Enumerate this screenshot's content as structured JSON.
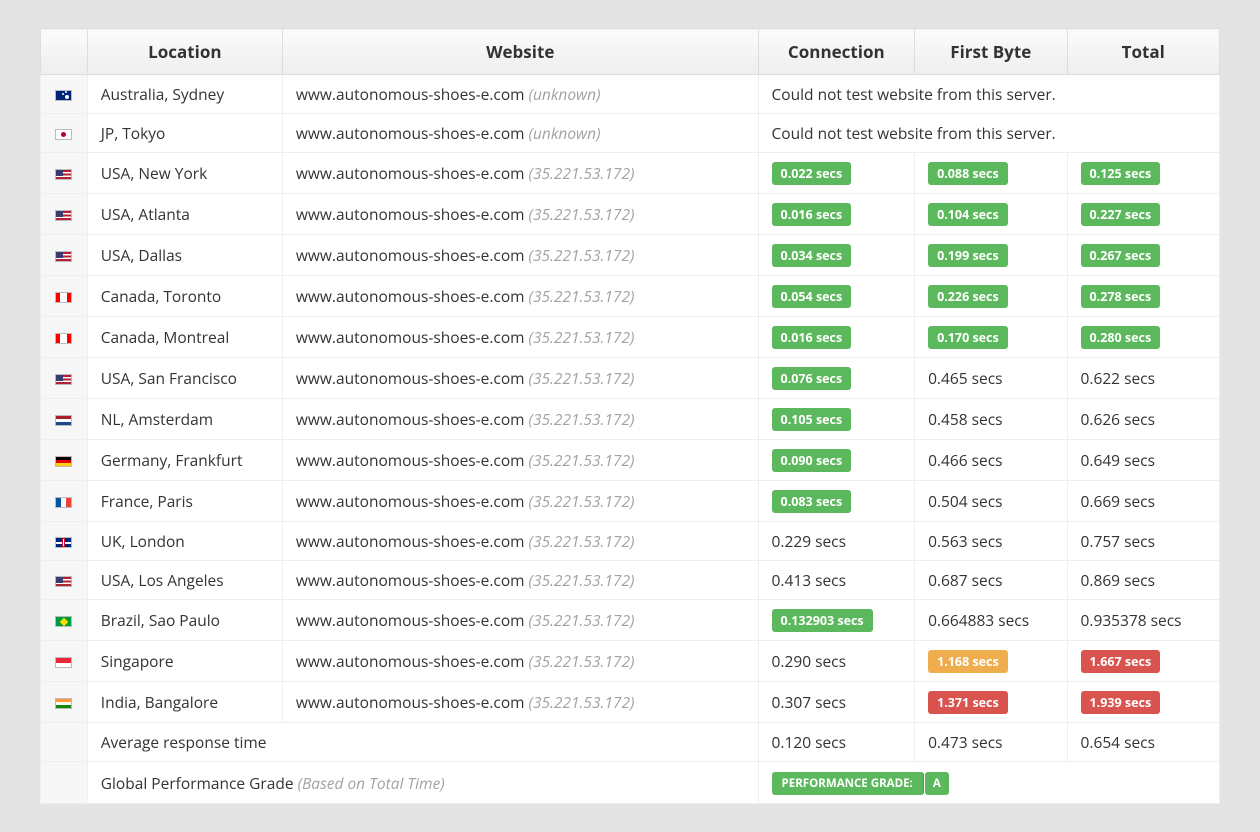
{
  "headers": {
    "location": "Location",
    "website": "Website",
    "connection": "Connection",
    "first_byte": "First Byte",
    "total": "Total"
  },
  "site": {
    "domain": "www.autonomous-shoes-e.com",
    "ip": "(35.221.53.172)",
    "unknown": "(unknown)"
  },
  "error_msg": "Could not test website from this server.",
  "rows": [
    {
      "flag": "au",
      "location": "Australia, Sydney",
      "ip_shown": false,
      "error": true
    },
    {
      "flag": "jp",
      "location": "JP, Tokyo",
      "ip_shown": false,
      "error": true
    },
    {
      "flag": "us",
      "location": "USA, New York",
      "ip_shown": true,
      "conn": {
        "v": "0.022 secs",
        "c": "green"
      },
      "fb": {
        "v": "0.088 secs",
        "c": "green"
      },
      "tot": {
        "v": "0.125 secs",
        "c": "green"
      }
    },
    {
      "flag": "us",
      "location": "USA, Atlanta",
      "ip_shown": true,
      "conn": {
        "v": "0.016 secs",
        "c": "green"
      },
      "fb": {
        "v": "0.104 secs",
        "c": "green"
      },
      "tot": {
        "v": "0.227 secs",
        "c": "green"
      }
    },
    {
      "flag": "us",
      "location": "USA, Dallas",
      "ip_shown": true,
      "conn": {
        "v": "0.034 secs",
        "c": "green"
      },
      "fb": {
        "v": "0.199 secs",
        "c": "green"
      },
      "tot": {
        "v": "0.267 secs",
        "c": "green"
      }
    },
    {
      "flag": "ca",
      "location": "Canada, Toronto",
      "ip_shown": true,
      "conn": {
        "v": "0.054 secs",
        "c": "green"
      },
      "fb": {
        "v": "0.226 secs",
        "c": "green"
      },
      "tot": {
        "v": "0.278 secs",
        "c": "green"
      }
    },
    {
      "flag": "ca",
      "location": "Canada, Montreal",
      "ip_shown": true,
      "conn": {
        "v": "0.016 secs",
        "c": "green"
      },
      "fb": {
        "v": "0.170 secs",
        "c": "green"
      },
      "tot": {
        "v": "0.280 secs",
        "c": "green"
      }
    },
    {
      "flag": "us",
      "location": "USA, San Francisco",
      "ip_shown": true,
      "conn": {
        "v": "0.076 secs",
        "c": "green"
      },
      "fb": {
        "v": "0.465 secs",
        "c": "plain"
      },
      "tot": {
        "v": "0.622 secs",
        "c": "plain"
      }
    },
    {
      "flag": "nl",
      "location": "NL, Amsterdam",
      "ip_shown": true,
      "conn": {
        "v": "0.105 secs",
        "c": "green"
      },
      "fb": {
        "v": "0.458 secs",
        "c": "plain"
      },
      "tot": {
        "v": "0.626 secs",
        "c": "plain"
      }
    },
    {
      "flag": "de",
      "location": "Germany, Frankfurt",
      "ip_shown": true,
      "conn": {
        "v": "0.090 secs",
        "c": "green"
      },
      "fb": {
        "v": "0.466 secs",
        "c": "plain"
      },
      "tot": {
        "v": "0.649 secs",
        "c": "plain"
      }
    },
    {
      "flag": "fr",
      "location": "France, Paris",
      "ip_shown": true,
      "conn": {
        "v": "0.083 secs",
        "c": "green"
      },
      "fb": {
        "v": "0.504 secs",
        "c": "plain"
      },
      "tot": {
        "v": "0.669 secs",
        "c": "plain"
      }
    },
    {
      "flag": "gb",
      "location": "UK, London",
      "ip_shown": true,
      "conn": {
        "v": "0.229 secs",
        "c": "plain"
      },
      "fb": {
        "v": "0.563 secs",
        "c": "plain"
      },
      "tot": {
        "v": "0.757 secs",
        "c": "plain"
      }
    },
    {
      "flag": "us",
      "location": "USA, Los Angeles",
      "ip_shown": true,
      "conn": {
        "v": "0.413 secs",
        "c": "plain"
      },
      "fb": {
        "v": "0.687 secs",
        "c": "plain"
      },
      "tot": {
        "v": "0.869 secs",
        "c": "plain"
      }
    },
    {
      "flag": "br",
      "location": "Brazil, Sao Paulo",
      "ip_shown": true,
      "conn": {
        "v": "0.132903 secs",
        "c": "green"
      },
      "fb": {
        "v": "0.664883 secs",
        "c": "plain"
      },
      "tot": {
        "v": "0.935378 secs",
        "c": "plain"
      }
    },
    {
      "flag": "sg",
      "location": "Singapore",
      "ip_shown": true,
      "conn": {
        "v": "0.290 secs",
        "c": "plain"
      },
      "fb": {
        "v": "1.168 secs",
        "c": "yellow"
      },
      "tot": {
        "v": "1.667 secs",
        "c": "red"
      }
    },
    {
      "flag": "in",
      "location": "India, Bangalore",
      "ip_shown": true,
      "conn": {
        "v": "0.307 secs",
        "c": "plain"
      },
      "fb": {
        "v": "1.371 secs",
        "c": "red"
      },
      "tot": {
        "v": "1.939 secs",
        "c": "red"
      }
    }
  ],
  "average": {
    "label": "Average response time",
    "conn": "0.120 secs",
    "fb": "0.473 secs",
    "tot": "0.654 secs"
  },
  "grade": {
    "label": "Global Performance Grade",
    "note": "(Based on Total Time)",
    "badge": "PERFORMANCE GRADE:",
    "letter": "A"
  }
}
